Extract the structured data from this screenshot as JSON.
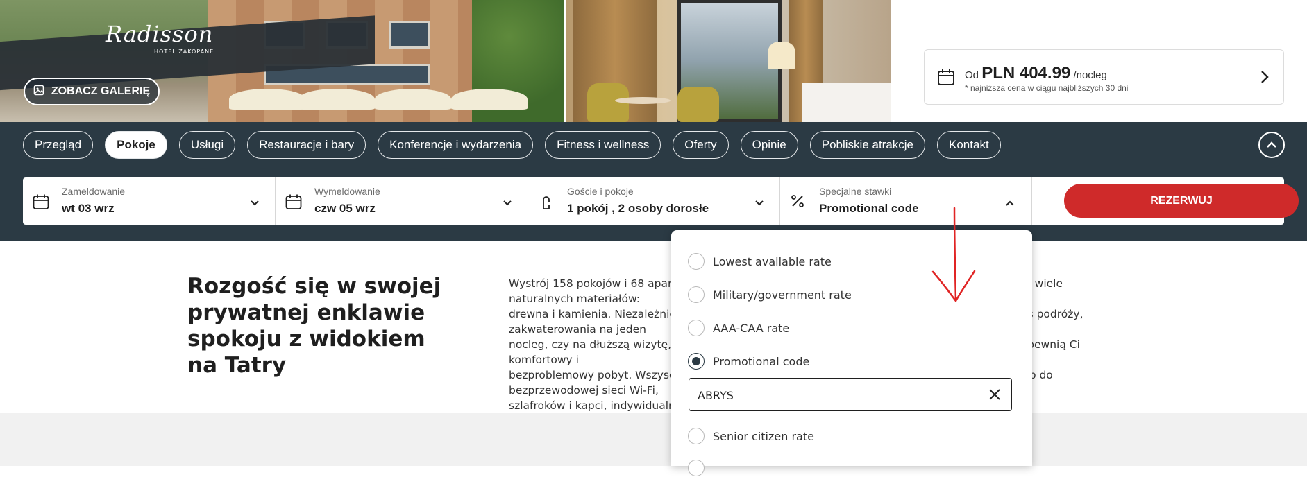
{
  "hero": {
    "logo_text": "Radisson",
    "logo_sub": "HOTEL ZAKOPANE",
    "gallery_label": "ZOBACZ GALERIĘ"
  },
  "price_card": {
    "prefix": "Od",
    "amount": "PLN 404.99",
    "unit": "/nocleg",
    "note": "* najniższa cena w ciągu najbliższych 30 dni"
  },
  "nav": {
    "items": [
      {
        "label": "Przegląd"
      },
      {
        "label": "Pokoje",
        "active": true
      },
      {
        "label": "Usługi"
      },
      {
        "label": "Restauracje i bary"
      },
      {
        "label": "Konferencje i wydarzenia"
      },
      {
        "label": "Fitness i wellness"
      },
      {
        "label": "Oferty"
      },
      {
        "label": "Opinie"
      },
      {
        "label": "Pobliskie atrakcje"
      },
      {
        "label": "Kontakt"
      }
    ]
  },
  "booking": {
    "checkin": {
      "label": "Zameldowanie",
      "value": "wt 03 wrz"
    },
    "checkout": {
      "label": "Wymeldowanie",
      "value": "czw 05 wrz"
    },
    "guests": {
      "label": "Goście i pokoje",
      "value": "1 pokój , 2 osoby dorosłe"
    },
    "rates": {
      "label": "Specjalne stawki",
      "value": "Promotional code"
    },
    "book_label": "REZERWUJ"
  },
  "content": {
    "headline": "Rozgość się w swojej prywatnej enklawie spokoju z widokiem na Tatry",
    "para_lines": [
      "Wystrój 158 pokojów i 68 apartamentów nawiązuje do tradycyjnego stylu regionu, wykorzystując wiele naturalnych materiałów:",
      "drewna i kamienia. Niezależnie od tego, czy szukasz wygodnego miejsca na krótki pobyt podczas podróży, zakwaterowania na jeden",
      "nocleg, czy na dłuższą wizytę, nasze pokoje i apartamenty oferują szeroki wybór możliwości i zapewnią Ci komfortowy i",
      "bezproblemowy pobyt. Wszyscy goście mogą korzystać z udogodnień takich jak bezpłatny dostęp do bezprzewodowej sieci Wi-Fi,",
      "szlafroków i kapci, indywidualnie sterowanej klimatyzacji."
    ]
  },
  "rates_dropdown": {
    "options": [
      {
        "label": "Lowest available rate",
        "selected": false
      },
      {
        "label": "Military/government rate",
        "selected": false
      },
      {
        "label": "AAA-CAA rate",
        "selected": false
      },
      {
        "label": "Promotional code",
        "selected": true
      },
      {
        "label": "Senior citizen rate",
        "selected": false
      }
    ],
    "promo_value": "ABRYS"
  },
  "colors": {
    "band": "#2b3a44",
    "accent_red": "#cf2a2a",
    "annotation": "#e02424"
  }
}
